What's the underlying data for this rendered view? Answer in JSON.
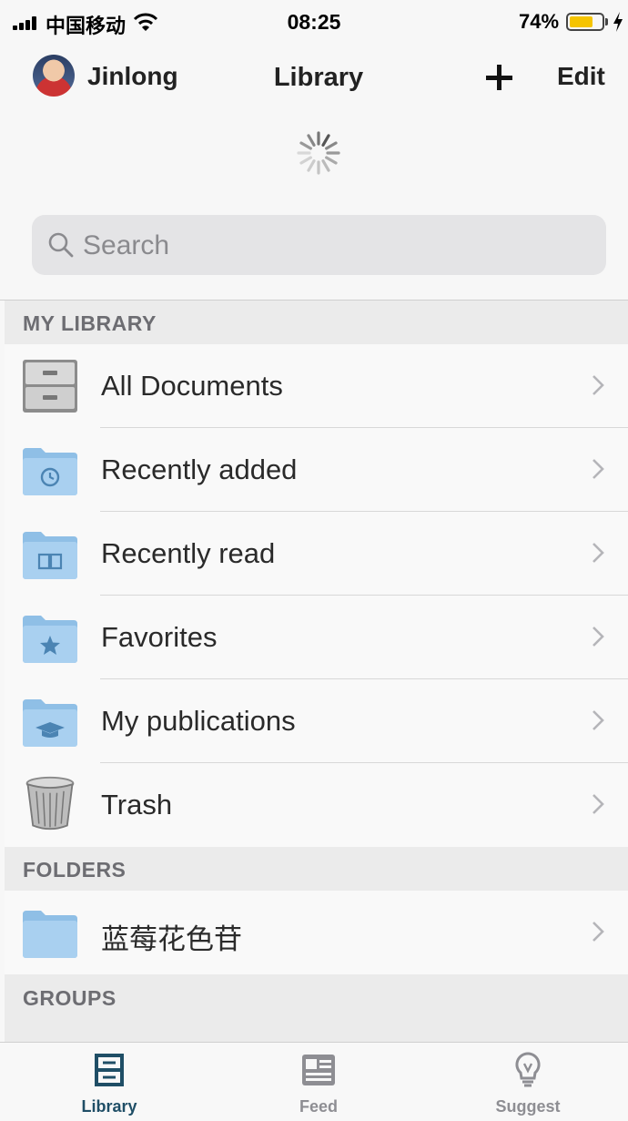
{
  "status_bar": {
    "carrier": "中国移动",
    "time": "08:25",
    "battery": "74%",
    "battery_level": 0.74
  },
  "nav": {
    "user_name": "Jinlong",
    "title": "Library",
    "edit_label": "Edit"
  },
  "search": {
    "placeholder": "Search"
  },
  "sections": {
    "my_library": "MY LIBRARY",
    "folders": "FOLDERS",
    "groups": "GROUPS"
  },
  "library_items": [
    {
      "label": "All Documents",
      "icon": "filing-cabinet-icon"
    },
    {
      "label": "Recently added",
      "icon": "folder-clock-icon"
    },
    {
      "label": "Recently read",
      "icon": "folder-book-icon"
    },
    {
      "label": "Favorites",
      "icon": "folder-star-icon"
    },
    {
      "label": "My publications",
      "icon": "folder-graduation-cap-icon"
    },
    {
      "label": "Trash",
      "icon": "trash-icon"
    }
  ],
  "folders": [
    {
      "label": "蓝莓花色苷",
      "icon": "folder-icon"
    }
  ],
  "tabs": [
    {
      "label": "Library",
      "icon": "library-icon",
      "active": true
    },
    {
      "label": "Feed",
      "icon": "feed-icon",
      "active": false
    },
    {
      "label": "Suggest",
      "icon": "lightbulb-icon",
      "active": false
    }
  ],
  "colors": {
    "accent": "#1f4e66",
    "inactive_tab": "#8e8e93",
    "folder_blue": "#a9d0f0",
    "battery": "#f5c400",
    "section_header": "#ebebeb"
  }
}
